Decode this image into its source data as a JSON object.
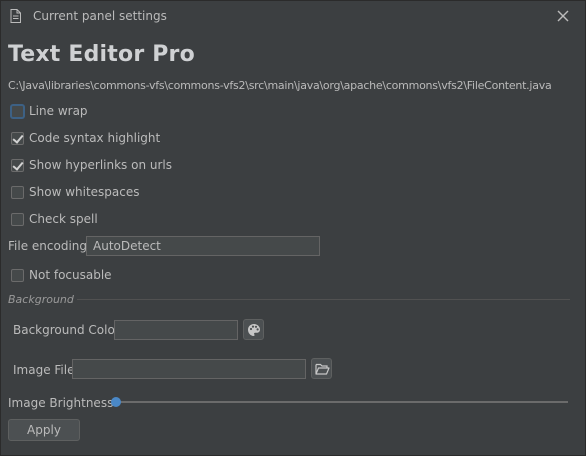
{
  "window": {
    "title": "Current panel settings"
  },
  "app": {
    "title": "Text Editor Pro",
    "file_path": "C:\\Java\\libraries\\commons-vfs\\commons-vfs2\\src\\main\\java\\org\\apache\\commons\\vfs2\\FileContent.java"
  },
  "options": {
    "line_wrap": {
      "label": "Line wrap",
      "checked": false
    },
    "code_syntax": {
      "label": "Code syntax highlight",
      "checked": true
    },
    "hyperlinks": {
      "label": "Show hyperlinks on urls",
      "checked": true
    },
    "whitespaces": {
      "label": "Show whitespaces",
      "checked": false
    },
    "check_spell": {
      "label": "Check spell",
      "checked": false
    },
    "not_focusable": {
      "label": "Not focusable",
      "checked": false
    }
  },
  "encoding": {
    "label": "File encoding",
    "value": "AutoDetect"
  },
  "background": {
    "section_label": "Background",
    "color_label": "Background Color",
    "color_value": "",
    "image_label": "Image File",
    "image_value": "",
    "brightness_label": "Image Brightness",
    "brightness": 0
  },
  "actions": {
    "apply_label": "Apply"
  },
  "colors": {
    "accent": "#4a88c7",
    "background": "#3c3f41",
    "text": "#bbbbbb"
  }
}
